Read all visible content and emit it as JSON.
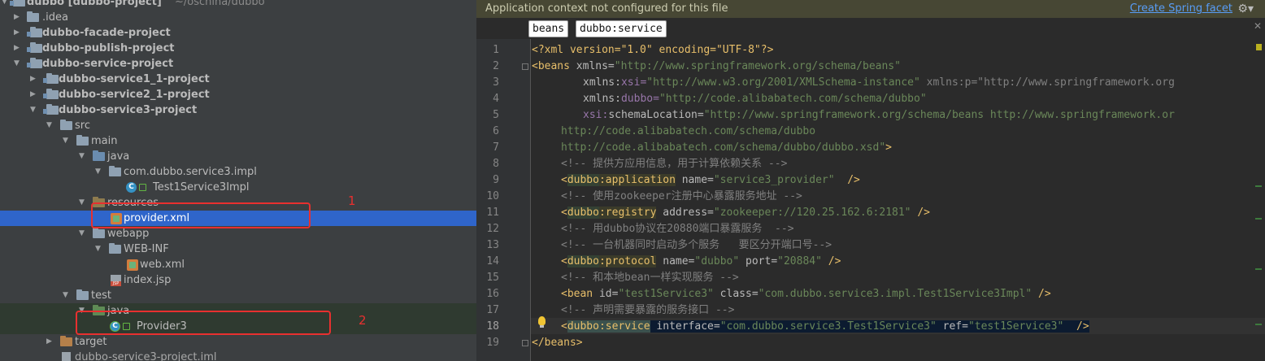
{
  "tree": {
    "root_label": "dubbo [dubbo-project]",
    "root_path": "~/oschina/dubbo",
    "items": [
      {
        "label": "dubbo [dubbo-project]"
      },
      {
        "label": ".idea"
      },
      {
        "label": "dubbo-facade-project"
      },
      {
        "label": "dubbo-publish-project"
      },
      {
        "label": "dubbo-service-project"
      },
      {
        "label": "dubbo-service1_1-project"
      },
      {
        "label": "dubbo-service2_1-project"
      },
      {
        "label": "dubbo-service3-project"
      },
      {
        "label": "src"
      },
      {
        "label": "main"
      },
      {
        "label": "java"
      },
      {
        "label": "com.dubbo.service3.impl"
      },
      {
        "label": "Test1Service3Impl"
      },
      {
        "label": "resources"
      },
      {
        "label": "provider.xml"
      },
      {
        "label": "webapp"
      },
      {
        "label": "WEB-INF"
      },
      {
        "label": "web.xml"
      },
      {
        "label": "index.jsp"
      },
      {
        "label": "test"
      },
      {
        "label": "java"
      },
      {
        "label": "Provider3"
      },
      {
        "label": "target"
      },
      {
        "label": "dubbo-service3-project.iml"
      }
    ],
    "annotations": [
      "1",
      "2"
    ]
  },
  "editor": {
    "banner": {
      "message": "Application context not configured for this file",
      "link": "Create Spring facet",
      "gear": "⚙▾"
    },
    "breadcrumbs": [
      "beans",
      "dubbo:service"
    ],
    "current_line": 18,
    "lines": [
      {
        "n": "1"
      },
      {
        "n": "2"
      },
      {
        "n": "3"
      },
      {
        "n": "4"
      },
      {
        "n": "5"
      },
      {
        "n": "6"
      },
      {
        "n": "7"
      },
      {
        "n": "8"
      },
      {
        "n": "9"
      },
      {
        "n": "10"
      },
      {
        "n": "11"
      },
      {
        "n": "12"
      },
      {
        "n": "13"
      },
      {
        "n": "14"
      },
      {
        "n": "15"
      },
      {
        "n": "16"
      },
      {
        "n": "17"
      },
      {
        "n": "18"
      },
      {
        "n": "19"
      }
    ],
    "code": {
      "l1": {
        "text": "<?xml version=\"1.0\" encoding=\"UTF-8\"?>"
      },
      "l2": {
        "open": "<beans",
        "attr": " xmlns=",
        "val": "\"http://www.springframework.org/schema/beans\""
      },
      "l3": {
        "ns": "xmlns:",
        "attr": "xsi=",
        "val": "\"http://www.w3.org/2001/XMLSchema-instance\"",
        "attr2": " xmlns:p=",
        "val2": "\"http://www.springframework.org"
      },
      "l4": {
        "ns": "xmlns:",
        "attr": "dubbo=",
        "val": "\"http://code.alibabatech.com/schema/dubbo\""
      },
      "l5": {
        "ns": "xsi:",
        "attr": "schemaLocation=",
        "val": "\"http://www.springframework.org/schema/beans http://www.springframework.or"
      },
      "l6": {
        "val": "http://code.alibabatech.com/schema/dubbo"
      },
      "l7": {
        "val": "http://code.alibabatech.com/schema/dubbo/dubbo.xsd\"",
        "close": ">"
      },
      "l8": {
        "comment": "<!-- 提供方应用信息，用于计算依赖关系 -->"
      },
      "l9": {
        "lt": "<",
        "dubbo": "dubbo",
        "colon": ":",
        "tag": "application",
        "attr": " name=",
        "val": "\"service3_provider\"",
        "close": "  />"
      },
      "l10": {
        "comment": "<!-- 使用zookeeper注册中心暴露服务地址 -->"
      },
      "l11": {
        "lt": "<",
        "dubbo": "dubbo",
        "colon": ":",
        "tag": "registry",
        "attr": " address=",
        "val": "\"zookeeper://120.25.162.6:2181\"",
        "close": " />"
      },
      "l12": {
        "comment": "<!-- 用dubbo协议在20880端口暴露服务  -->"
      },
      "l13": {
        "comment": "<!-- 一台机器同时启动多个服务   要区分开端口号-->"
      },
      "l14": {
        "lt": "<",
        "dubbo": "dubbo",
        "colon": ":",
        "tag": "protocol",
        "attr": " name=",
        "val": "\"dubbo\"",
        "attr2": " port=",
        "val2": "\"20884\"",
        "close": " />"
      },
      "l15": {
        "comment": "<!-- 和本地bean一样实现服务 -->"
      },
      "l16": {
        "open": "<bean",
        "attr": " id=",
        "val": "\"test1Service3\"",
        "attr2": " class=",
        "val2": "\"com.dubbo.service3.impl.Test1Service3Impl\"",
        "close": " />"
      },
      "l17": {
        "comment": "<!-- 声明需要暴露的服务接口 -->"
      },
      "l18": {
        "lt": "<",
        "dubbo": "dubbo",
        "colon": ":",
        "tag": "service",
        "attr": " interface=",
        "val": "\"com.dubbo.service3.Test1Service3\"",
        "attr2": " ref=",
        "val2": "\"test1Service3\"",
        "close": "  />"
      },
      "l19": {
        "text": "</beans>"
      }
    },
    "colors": {
      "background": "#2b2b2b",
      "tag": "#e8bf6a",
      "string": "#6a8759",
      "comment": "#808080",
      "namespace": "#9876aa",
      "selection": "#2f65ca",
      "annotation": "#e8302f"
    }
  }
}
